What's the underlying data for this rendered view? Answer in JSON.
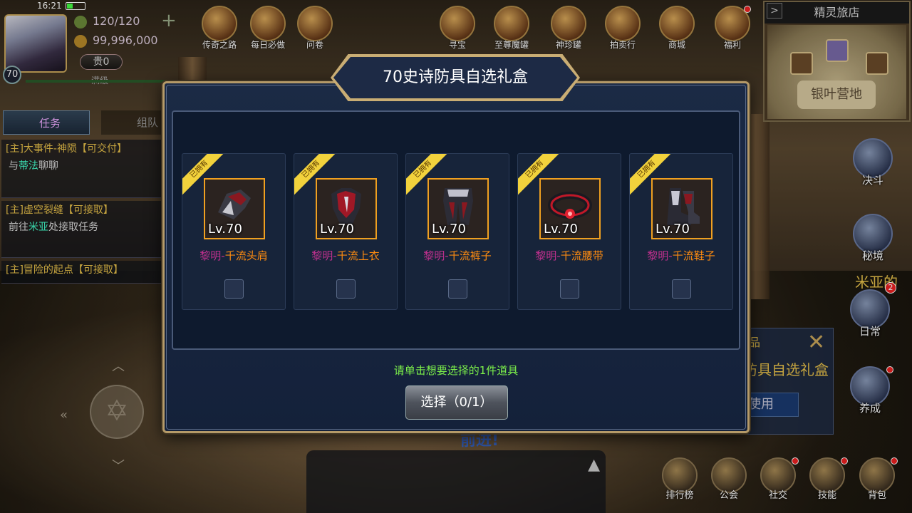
{
  "status": {
    "time": "16:21"
  },
  "player": {
    "level": "70",
    "stamina": "120/120",
    "gold": "99,996,000",
    "vip": "贵0",
    "vip_status": "满级"
  },
  "top_icons": [
    {
      "label": "传奇之路"
    },
    {
      "label": "每日必做"
    },
    {
      "label": "问卷"
    },
    {
      "label": "寻宝"
    },
    {
      "label": "至尊魔罐"
    },
    {
      "label": "神珍罐"
    },
    {
      "label": "拍卖行"
    },
    {
      "label": "商城"
    },
    {
      "label": "福利"
    }
  ],
  "task_tabs": {
    "task": "任务",
    "team": "组队"
  },
  "tasks": [
    {
      "title": "[主]大事件-神陨【可交付】",
      "desc_prefix": "与",
      "desc_hl": "蒂法",
      "desc_suffix": "聊聊"
    },
    {
      "title": "[主]虚空裂缝【可接取】",
      "desc_prefix": "前往",
      "desc_hl": "米亚",
      "desc_suffix": "处接取任务"
    },
    {
      "title": "[主]冒险的起点【可接取】",
      "desc_prefix": "",
      "desc_hl": "",
      "desc_suffix": ""
    }
  ],
  "minimap": {
    "title": "精灵旅店",
    "place": "银叶营地"
  },
  "right_icons": [
    {
      "label": "决斗"
    },
    {
      "label": "秘境"
    },
    {
      "label": "日常"
    },
    {
      "label": "养成"
    }
  ],
  "bottom_icons": [
    {
      "label": "排行榜"
    },
    {
      "label": "公会"
    },
    {
      "label": "社交"
    },
    {
      "label": "技能"
    },
    {
      "label": "背包"
    }
  ],
  "background_tip": {
    "line1": "品",
    "line2": "防具自选礼盒",
    "button": "使用",
    "badge": "2",
    "side_text": "米亚的"
  },
  "modal": {
    "title": "70史诗防具自选礼盒",
    "hint": "请单击想要选择的1件道具",
    "select_button": "选择（0/1）",
    "items": [
      {
        "badge": "已拥有",
        "level": "Lv.70",
        "prefix": "黎明-",
        "name": "千流头肩",
        "checked": false
      },
      {
        "badge": "已拥有",
        "level": "Lv.70",
        "prefix": "黎明-",
        "name": "千流上衣",
        "checked": false
      },
      {
        "badge": "已拥有",
        "level": "Lv.70",
        "prefix": "黎明-",
        "name": "千流裤子",
        "checked": false
      },
      {
        "badge": "已拥有",
        "level": "Lv.70",
        "prefix": "黎明-",
        "name": "千流腰带",
        "checked": false
      },
      {
        "badge": "已拥有",
        "level": "Lv.70",
        "prefix": "黎明-",
        "name": "千流鞋子",
        "checked": false
      }
    ]
  },
  "behind_text": "前进!",
  "colors": {
    "accent_gold": "#c9ad74",
    "item_name": "#ff8c10",
    "item_prefix": "#c0308e",
    "hint": "#7cf04a",
    "frame_bg": "#1b2a45"
  }
}
